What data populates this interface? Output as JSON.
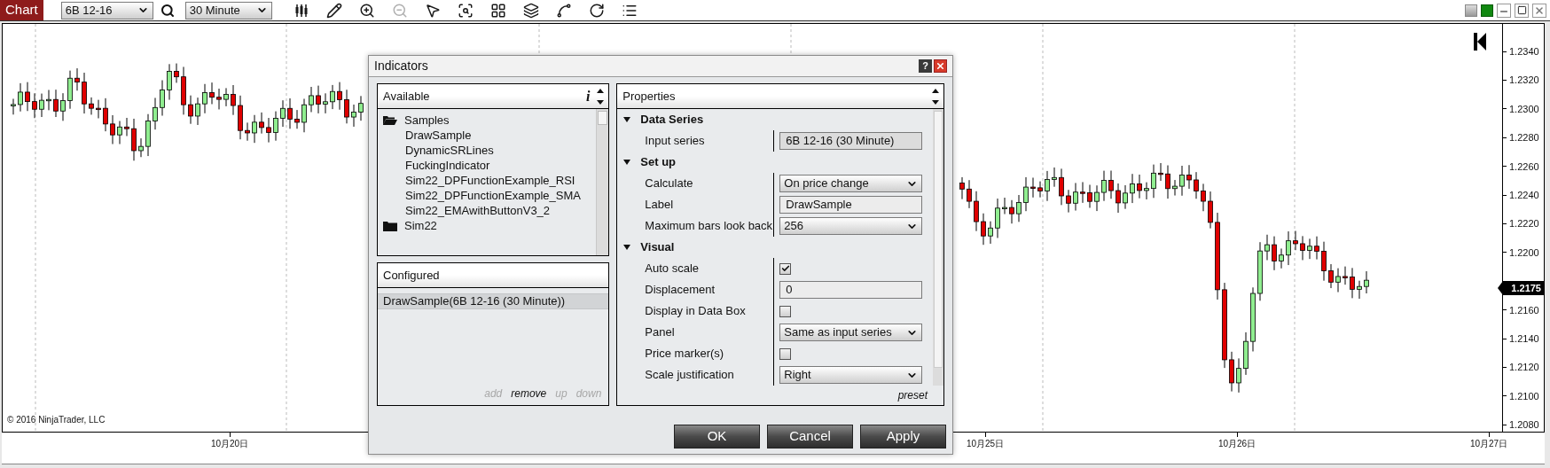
{
  "toolbar": {
    "tab": "Chart",
    "instrument": "6B 12-16",
    "interval": "30 Minute",
    "tools": [
      {
        "kind": "bars",
        "disabled": false
      },
      {
        "kind": "pencil",
        "disabled": false
      },
      {
        "kind": "zoom-in",
        "disabled": false
      },
      {
        "kind": "zoom-out",
        "disabled": true
      },
      {
        "kind": "pointer",
        "disabled": false
      },
      {
        "kind": "data-box",
        "disabled": false
      },
      {
        "kind": "grid",
        "disabled": false
      },
      {
        "kind": "layers",
        "disabled": false
      },
      {
        "kind": "spline",
        "disabled": false
      },
      {
        "kind": "refresh",
        "disabled": false
      },
      {
        "kind": "list",
        "disabled": false
      }
    ]
  },
  "chart": {
    "price_labels": [
      "1.2340",
      "1.2320",
      "1.2300",
      "1.2280",
      "1.2260",
      "1.2240",
      "1.2220",
      "1.2200",
      "1.2160",
      "1.2140",
      "1.2120",
      "1.2100",
      "1.2080"
    ],
    "current_price": "1.2175",
    "date_labels": [
      "10月20日",
      "10月25日",
      "10月26日",
      "10月27日"
    ],
    "copyright": "© 2016 NinjaTrader, LLC"
  },
  "dialog": {
    "title": "Indicators",
    "help": "?",
    "available": {
      "title": "Available",
      "info": "i",
      "folders": [
        {
          "name": "Samples",
          "expanded": true,
          "children": [
            {
              "name": "DrawSample"
            },
            {
              "name": "DynamicSRLines"
            },
            {
              "name": "FuckingIndicator"
            },
            {
              "name": "Sim22_DPFunctionExample_RSI"
            },
            {
              "name": "Sim22_DPFunctionExample_SMA"
            },
            {
              "name": "Sim22_EMAwithButtonV3_2"
            }
          ]
        },
        {
          "name": "Sim22",
          "expanded": false
        }
      ]
    },
    "configured": {
      "title": "Configured",
      "items": [
        {
          "label": "DrawSample(6B 12-16 (30 Minute))",
          "selected": true
        }
      ],
      "actions": [
        {
          "label": "add",
          "disabled": true
        },
        {
          "label": "remove",
          "disabled": false
        },
        {
          "label": "up",
          "disabled": true
        },
        {
          "label": "down",
          "disabled": true
        }
      ]
    },
    "properties": {
      "title": "Properties",
      "preset": "preset",
      "categories": [
        {
          "name": "Data Series",
          "expanded": true,
          "rows": [
            {
              "label": "Input series",
              "kind": "readonly",
              "value": "6B 12-16 (30 Minute)"
            }
          ]
        },
        {
          "name": "Set up",
          "expanded": true,
          "rows": [
            {
              "label": "Calculate",
              "kind": "select",
              "value": "On price change"
            },
            {
              "label": "Label",
              "kind": "text",
              "value": "DrawSample"
            },
            {
              "label": "Maximum bars look back",
              "kind": "select",
              "value": "256"
            }
          ]
        },
        {
          "name": "Visual",
          "expanded": true,
          "rows": [
            {
              "label": "Auto scale",
              "kind": "checkbox",
              "checked": true
            },
            {
              "label": "Displacement",
              "kind": "text",
              "value": "0"
            },
            {
              "label": "Display in Data Box",
              "kind": "checkbox",
              "checked": false
            },
            {
              "label": "Panel",
              "kind": "select",
              "value": "Same as input series"
            },
            {
              "label": "Price marker(s)",
              "kind": "checkbox",
              "checked": false
            },
            {
              "label": "Scale justification",
              "kind": "select",
              "value": "Right"
            }
          ]
        }
      ]
    },
    "buttons": [
      "OK",
      "Cancel",
      "Apply"
    ]
  }
}
